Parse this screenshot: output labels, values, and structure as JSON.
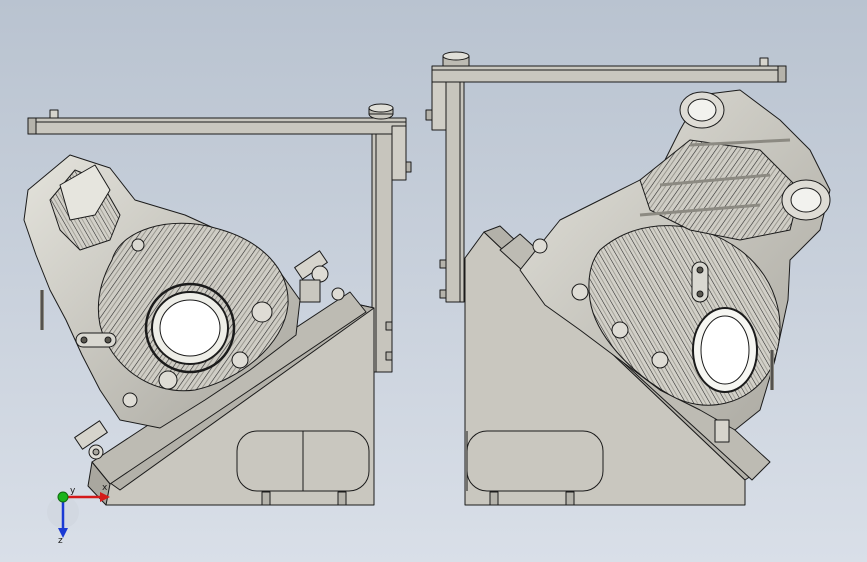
{
  "viewport": {
    "background_top": "#b9c3d0",
    "background_bottom": "#d9dfe8",
    "part_fill": "#c9c7bf",
    "part_shade": "#a9a79f",
    "edge_color": "#1b1b1b"
  },
  "triad": {
    "x_label": "x",
    "y_label": "y",
    "z_label": "z",
    "x_color": "#d41a1a",
    "y_color": "#1bb41b",
    "z_color": "#1a3ad4"
  }
}
